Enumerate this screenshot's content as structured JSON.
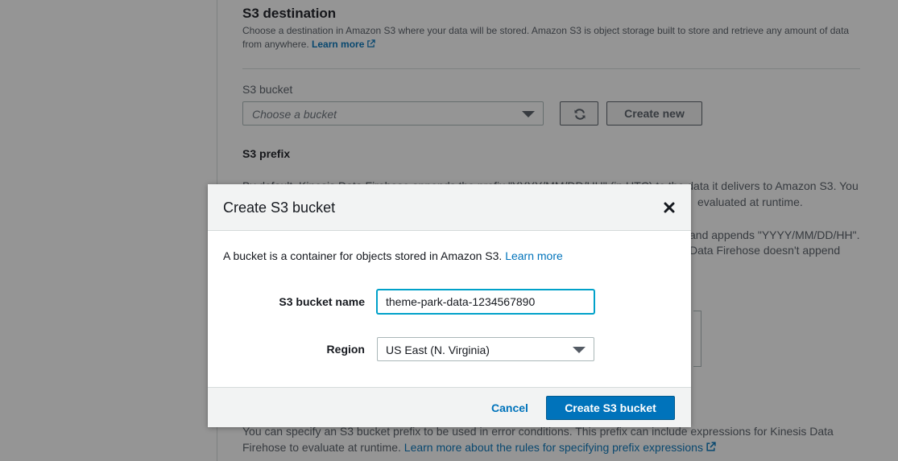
{
  "background": {
    "section_title": "S3 destination",
    "section_description": "Choose a destination in Amazon S3 where your data will be stored. Amazon S3 is object storage built to store and retrieve any amount of data from anywhere.",
    "learn_more_label": "Learn more",
    "bucket_label": "S3 bucket",
    "bucket_placeholder": "Choose a bucket",
    "create_new_label": "Create new",
    "prefix_title": "S3 prefix",
    "prefix_text_line1": "By default, Kinesis Data Firehose appends the prefix \"YYYY/MM/DD/HH\" (in UTC) to the data it delivers to Amazon S3. You",
    "prefix_text_line2": "evaluated at runtime.",
    "prefix_text_line3": "and appends \"YYYY/MM/DD/HH\".",
    "prefix_text_line4": "Data Firehose doesn't append",
    "error_prefix_text": "You can specify an S3 bucket prefix to be used in error conditions. This prefix can include expressions for Kinesis Data Firehose to evaluate at runtime.",
    "error_prefix_link": "Learn more about the rules for specifying prefix expressions"
  },
  "modal": {
    "title": "Create S3 bucket",
    "intro_text": "A bucket is a container for objects stored in Amazon S3.",
    "intro_link": "Learn more",
    "bucket_name_label": "S3 bucket name",
    "bucket_name_value": "theme-park-data-1234567890",
    "region_label": "Region",
    "region_value": "US East (N. Virginia)",
    "cancel_label": "Cancel",
    "create_label": "Create S3 bucket"
  },
  "colors": {
    "accent": "#0073bb",
    "focus": "#00a1c9"
  }
}
